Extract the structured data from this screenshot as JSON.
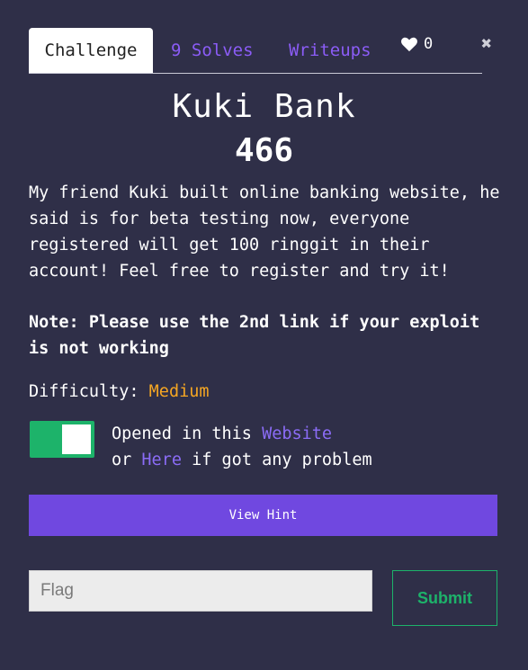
{
  "tabs": {
    "challenge": "Challenge",
    "solves": "9 Solves",
    "writeups": "Writeups"
  },
  "likes": "0",
  "challenge": {
    "name": "Kuki Bank",
    "points": "466",
    "description": "My friend Kuki built online banking website, he said is for beta testing now, everyone registered will get 100 ringgit in their account! Feel free to register and try it!",
    "note": "Note: Please use the 2nd link if your exploit is not working",
    "difficulty_label": "Difficulty:",
    "difficulty_value": "Medium"
  },
  "links": {
    "opened_prefix": "Opened in this",
    "website_link": "Website",
    "or_text": "or",
    "here_link": "Here",
    "suffix": "if got any problem"
  },
  "hint_button": "View Hint",
  "flag": {
    "placeholder": "Flag",
    "submit_label": "Submit"
  },
  "colors": {
    "background": "#2f2f48",
    "accent": "#7048e0",
    "difficulty": "#f5a623",
    "success": "#1db36a"
  },
  "toggle_on": true
}
